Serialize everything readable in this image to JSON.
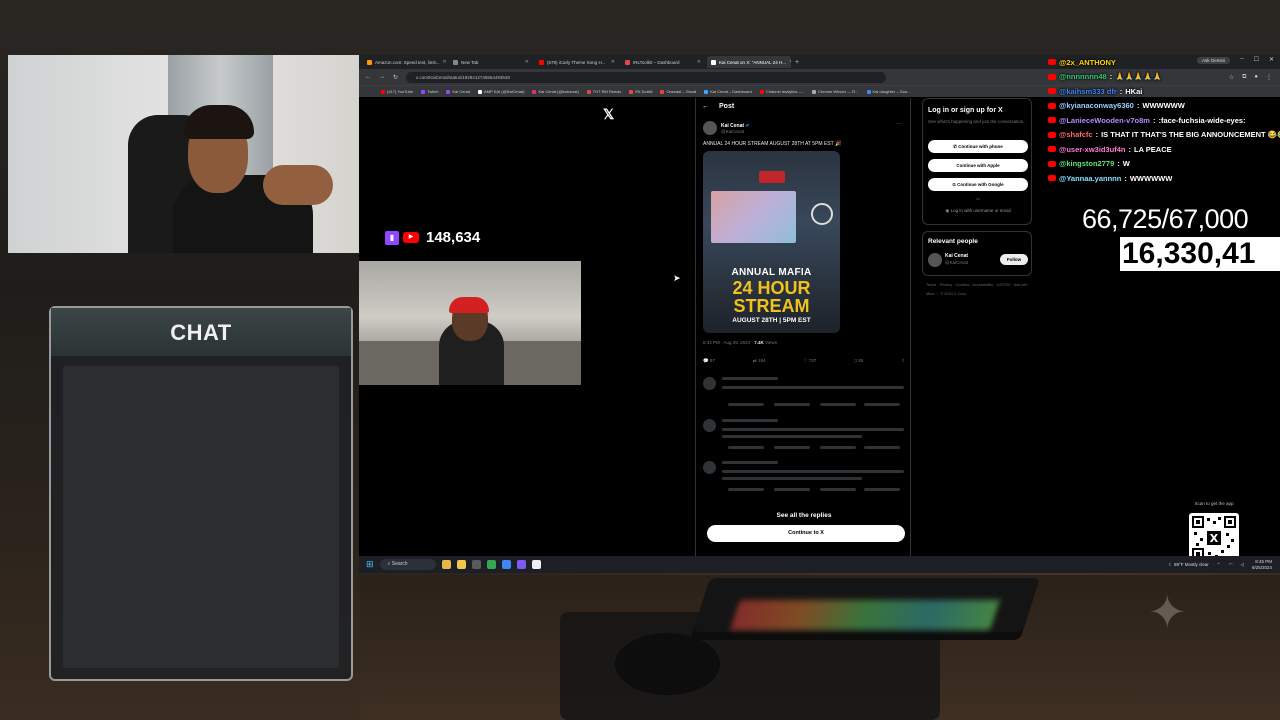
{
  "overlay": {
    "chat_title": "CHAT",
    "goal_counter": "66,725/67,000",
    "sub_counter": "16,330,41"
  },
  "stream_chat": [
    {
      "user": "@2x_ANTHONY",
      "message": "",
      "color": "#ffd700"
    },
    {
      "user": "@nnnnnnn48",
      "message": "🙏🙏🙏🙏🙏",
      "color": "#2ecc71"
    },
    {
      "user": "@kaihsm333 dfr",
      "message": "HKai",
      "color": "#3b82f6"
    },
    {
      "user": "@kyianaconway6360",
      "message": "WWWWWW",
      "color": "#9ad0ff"
    },
    {
      "user": "@LanieceWooden-v7o8m",
      "message": ":face-fuchsia-wide-eyes:",
      "color": "#b48cff"
    },
    {
      "user": "@shafcfc",
      "message": "IS THAT IT THAT'S THE BIG ANNOUNCEMENT 😂😂😂😂",
      "color": "#ff6b6b"
    },
    {
      "user": "@user-xw3id3uf4n",
      "message": "LA PEACE",
      "color": "#ff7bd5"
    },
    {
      "user": "@kingston2779",
      "message": "W",
      "color": "#5fe07a"
    },
    {
      "user": "@Yannaa.yannnn",
      "message": "WWWWWW",
      "color": "#7fe3ff"
    }
  ],
  "browser": {
    "tabs": [
      {
        "label": "Amazon.com: Speed test, limit...",
        "color": "#ff9900",
        "active": false
      },
      {
        "label": "New Tab",
        "color": "#888888",
        "active": false
      },
      {
        "label": "(679) iCarly Theme Song H...",
        "color": "#ff0000",
        "active": false
      },
      {
        "label": "IRLToolkit – Dashboard",
        "color": "#e04848",
        "active": false
      },
      {
        "label": "Kai Cenat on X: \"ANNUAL 24 H...",
        "color": "#ffffff",
        "active": true
      }
    ],
    "address": "x.com/KaiCenat/status/1828412745554493649",
    "gemini_label": "Ask Gemini",
    "bookmarks": [
      {
        "label": "(417) YouTube",
        "color": "#ff0000"
      },
      {
        "label": "Twitch",
        "color": "#9146ff"
      },
      {
        "label": "Kai Cenat",
        "color": "#9146ff"
      },
      {
        "label": "AMP KAI (@KaiCenat)",
        "color": "#ffffff"
      },
      {
        "label": "Kai Cenat (@kaicenat)",
        "color": "#e1306c"
      },
      {
        "label": "THT RM Rewds",
        "color": "#e04848"
      },
      {
        "label": "IRLToolkit",
        "color": "#e04848"
      },
      {
        "label": "Onecast – Gmail",
        "color": "#ea4335"
      },
      {
        "label": "Kai Cenat – Dashboard",
        "color": "#3ea6ff"
      },
      {
        "label": "Channel analytics –...",
        "color": "#ff0000"
      },
      {
        "label": "Chrome Winner — R...",
        "color": "#aaaaaa"
      },
      {
        "label": "Kai daughter – Goo...",
        "color": "#4285f4"
      }
    ]
  },
  "stream": {
    "viewer_count": "148,634"
  },
  "post": {
    "header": "Post",
    "author_name": "Kai Cenat",
    "author_handle": "@KaiCenat",
    "text": "ANNUAL 24 HOUR STREAM AUGUST 28TH AT 5PM EST 🎉",
    "image_line1": "ANNUAL MAFIA",
    "image_line2": "24 HOUR STREAM",
    "image_line3": "AUGUST 28TH | 5PM EST",
    "time": "8:44 PM · Aug 25, 2024 · ",
    "views": "7.4K",
    "views_label": " Views",
    "replies": "67",
    "reposts": "184",
    "likes": "737",
    "bookmarks": "25",
    "see_replies": "See all the replies",
    "continue": "Continue to X"
  },
  "login": {
    "title": "Log in or sign up for X",
    "subtitle": "See what's happening and join the conversation.",
    "phone": "Continue with phone",
    "apple": "Continue with Apple",
    "google": "Continue with Google",
    "or": "or",
    "username": "Log in with username or email"
  },
  "relevant": {
    "title": "Relevant people",
    "name": "Kai Cenat",
    "handle": "@KaiCenat",
    "follow": "Follow"
  },
  "footer": "Terms · Privacy · Cookies · Accessibility · US/TOS · Ads info · More ··· © 2024 X Corp.",
  "qr": {
    "label": "Scan to get the app"
  },
  "taskbar": {
    "search": "Search",
    "weather": "89°F Mostly clear",
    "time": "8:45 PM",
    "date": "8/25/2024"
  }
}
